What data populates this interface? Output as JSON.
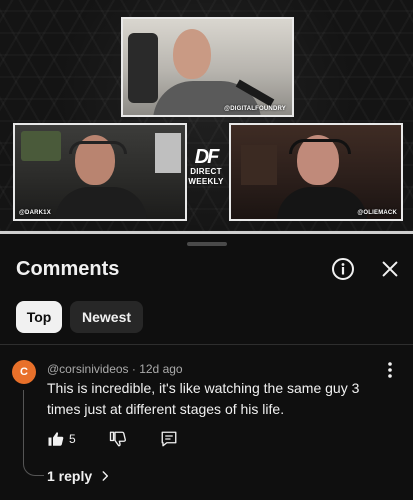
{
  "video": {
    "cams": {
      "top_tag": "@DIGITALFOUNDRY",
      "left_tag": "@DARK1X",
      "right_tag": "@OLIEMACK"
    },
    "logo": {
      "mark": "DF",
      "line1": "DIRECT",
      "line2": "WEEKLY"
    },
    "progress_fraction": 1.0
  },
  "comments_panel": {
    "title": "Comments",
    "header_icons": [
      "info-icon",
      "close-icon"
    ],
    "sort_chips": [
      {
        "label": "Top",
        "selected": true
      },
      {
        "label": "Newest",
        "selected": false
      }
    ],
    "comment": {
      "avatar_letter": "C",
      "avatar_color": "#e8702a",
      "author": "@corsinivideos",
      "age": "12d ago",
      "meta": "@corsinivideos · 12d ago",
      "text": "This is incredible, it's like watching the same guy 3 times just at different stages of his life.",
      "like_count": "5",
      "reply_label": "1 reply"
    }
  },
  "colors": {
    "background": "#0f0f0f",
    "chip_selected": "#f1f1f1",
    "chip_unselected": "#272727",
    "text_primary": "#f1f1f1",
    "text_secondary": "#aaaaaa"
  }
}
